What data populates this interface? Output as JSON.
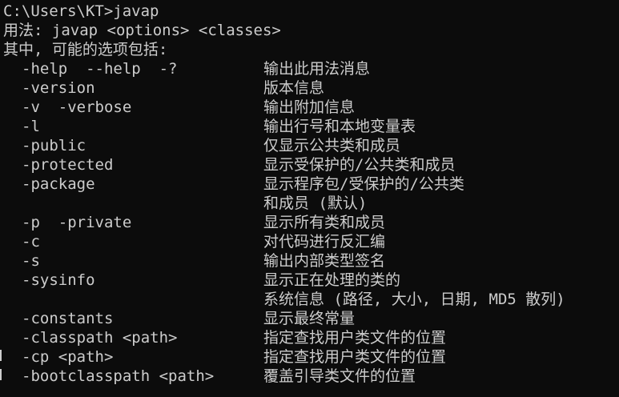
{
  "terminal": {
    "prompt_line": "C:\\Users\\KT>javap",
    "usage_line": "用法: javap <options> <classes>",
    "options_header": "其中, 可能的选项包括:"
  },
  "options": [
    {
      "flag": "-help  --help  -?",
      "description": "输出此用法消息"
    },
    {
      "flag": "-version",
      "description": "版本信息"
    },
    {
      "flag": "-v  -verbose",
      "description": "输出附加信息"
    },
    {
      "flag": "-l",
      "description": "输出行号和本地变量表"
    },
    {
      "flag": "-public",
      "description": "仅显示公共类和成员"
    },
    {
      "flag": "-protected",
      "description": "显示受保护的/公共类和成员"
    },
    {
      "flag": "-package",
      "description": "显示程序包/受保护的/公共类",
      "description_cont": "和成员 (默认)"
    },
    {
      "flag": "-p  -private",
      "description": "显示所有类和成员"
    },
    {
      "flag": "-c",
      "description": "对代码进行反汇编"
    },
    {
      "flag": "-s",
      "description": "输出内部类型签名"
    },
    {
      "flag": "-sysinfo",
      "description": "显示正在处理的类的",
      "description_cont": "系统信息 (路径, 大小, 日期, MD5 散列)"
    },
    {
      "flag": "-constants",
      "description": "显示最终常量"
    },
    {
      "flag": "-classpath <path>",
      "description": "指定查找用户类文件的位置"
    },
    {
      "flag": "-cp <path>",
      "description": "指定查找用户类文件的位置"
    },
    {
      "flag": "-bootclasspath <path>",
      "description": "覆盖引导类文件的位置"
    }
  ],
  "colors": {
    "background": "#0c0c0c",
    "text": "#cccccc"
  }
}
